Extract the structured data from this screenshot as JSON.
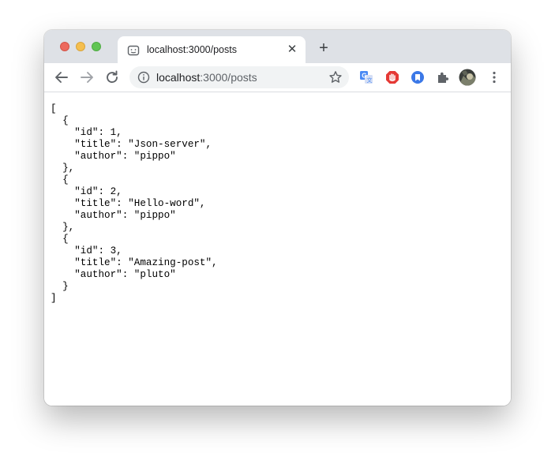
{
  "tab": {
    "title": "localhost:3000/posts",
    "close_label": "✕"
  },
  "newtab": {
    "label": "+"
  },
  "address": {
    "host": "localhost",
    "path": ":3000/posts"
  },
  "icons": {
    "back": "arrow-left",
    "forward": "arrow-right",
    "reload": "reload",
    "info": "info-circle",
    "bookmark": "star",
    "extensions": [
      "translate",
      "adblock",
      "bookmark-ext",
      "puzzle",
      "profile-avatar"
    ],
    "menu": "kebab-menu"
  },
  "json_lines": [
    "[",
    "  {",
    "    \"id\": 1,",
    "    \"title\": \"Json-server\",",
    "    \"author\": \"pippo\"",
    "  },",
    "  {",
    "    \"id\": 2,",
    "    \"title\": \"Hello-word\",",
    "    \"author\": \"pippo\"",
    "  },",
    "  {",
    "    \"id\": 3,",
    "    \"title\": \"Amazing-post\",",
    "    \"author\": \"pluto\"",
    "  }",
    "]"
  ]
}
